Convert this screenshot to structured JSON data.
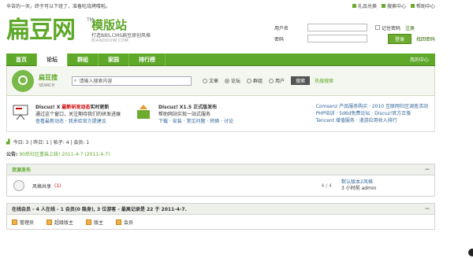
{
  "topbar": {
    "tip": "辛苦的一天，终于可以下班了，准备吃烧烤喽啦。",
    "links": [
      "礼品兑换",
      "搜索中心",
      "帮助中心"
    ]
  },
  "header": {
    "logo_text": "扁豆网",
    "tm": "TM",
    "site_name": "模版站",
    "tagline": "打造BBS,CMS扁豆原创风格",
    "domain": "BIANDOUW.COM"
  },
  "login": {
    "username_label": "用户名",
    "password_label": "密码",
    "remember": "记住密码",
    "register": "注册",
    "login_button": "登录",
    "forgot": "找回密码"
  },
  "nav": {
    "items": [
      "首页",
      "论坛",
      "群组",
      "家园",
      "排行榜"
    ],
    "active_index": 1,
    "my_center": "我的中心"
  },
  "search": {
    "title": "扁豆搜",
    "subtitle": "SEARCH",
    "placeholder": "请输入搜索内容",
    "options": [
      "文章",
      "论坛",
      "群组",
      "用户"
    ],
    "selected_option": "论坛",
    "button": "搜索",
    "hot": "热搜搜索"
  },
  "promo": {
    "item1": {
      "title": "Discuz! X",
      "highlight": "最新研发动态",
      "title_tail": "实时更新",
      "line1": "通过这个窗口，关注期待我们的研发进展",
      "links": [
        "查看最新动态",
        "我来给官方提建议"
      ]
    },
    "item2": {
      "title": "Discuz! X1.5 正式版发布",
      "line1": "帮助网站实现一站式服务",
      "links": [
        "下载",
        "安装",
        "常见问题",
        "转换",
        "讨论"
      ]
    },
    "right": [
      [
        "Comsenz 产品服务购买",
        "2010 互联网社区调查活动"
      ],
      [
        "PHP培训",
        "5d6d免费论坛",
        "Discuz!官方正版"
      ],
      [
        "Tencent 增值服务",
        "漫游应用收入排行"
      ]
    ]
  },
  "stats": {
    "text": "今日: 3 | 昨日: 1 | 帖子: 4 | 会员: 1"
  },
  "notice": {
    "label": "公告:",
    "text": "90后社区重装上线! 2011-4-7 (2011-4-7)"
  },
  "section": {
    "title": "资源发布",
    "collapse": "—",
    "forum_name": "风格共享",
    "forum_count": "(1)",
    "posts": "4 / 4",
    "last_title": "默认版本2风格",
    "last_meta": "3 小时前 admin"
  },
  "online": {
    "title": "在线会员 - 4 人在线 - 1 会员(0 隐身), 3 位游客 - 最高记录是 22 于 2011-4-7.",
    "collapse": "—",
    "legend": [
      "管理员",
      "超级版主",
      "版主",
      "会员"
    ]
  },
  "colors": {
    "accent": "#5ea82a",
    "link": "#336699",
    "alert": "#cc0000"
  }
}
